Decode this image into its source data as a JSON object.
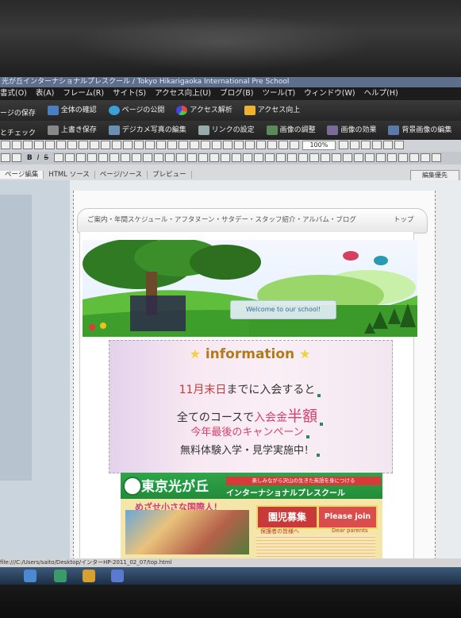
{
  "window": {
    "title": "光が丘インターナショナルプレスクール / Tokyo Hikarigaoka International Pre School"
  },
  "menu": [
    "書式(O)",
    "表(A)",
    "フレーム(R)",
    "サイト(S)",
    "アクセス向上(U)",
    "ブログ(B)",
    "ツール(T)",
    "ウィンドウ(W)",
    "ヘルプ(H)"
  ],
  "toolbar1": {
    "save": "ージの保存",
    "overall_check": "全体の確認",
    "publish": "ページの公開",
    "access_analysis": "アクセス解析",
    "access_up": "アクセス向上"
  },
  "toolbar2": {
    "check": "とチェック",
    "overwrite_save": "上書き保存",
    "photo_edit": "デジカメ写真の編集",
    "link_settings": "リンクの設定",
    "image_adjust": "画像の調整",
    "image_effect": "画像の効果",
    "bg_image_edit": "背景画像の編集"
  },
  "format": {
    "zoom": "100%"
  },
  "tabs": [
    "ページ編集",
    "HTML ソース",
    "ページ/ソース",
    "プレビュー"
  ],
  "mode_select": "編集優先",
  "page": {
    "nav_links": "ご案内・年間スケジュール・アフタヌーン・サタデー・スタッフ紹介・アルバム・ブログ",
    "nav_top": "トップ",
    "welcome": "Welcome to our school!",
    "info_title": "information",
    "line1_red": "11月末日",
    "line1_rest": "までに入会すると",
    "line2_a": "全てのコースで",
    "line2_b": "入会金",
    "line2_c": "半額",
    "line3": "今年最後のキャンペーン",
    "line4": "無料体験入学・見学実施中！",
    "school_name": "東京光が丘",
    "school_sub": "楽しみながら沢山の生きた英語を身につける",
    "school_sub2": "インターナショナルプレスクール",
    "mezase": "めざせ小さな国際人！",
    "enji": "園児募集",
    "join": "Please join us",
    "hogosha": "保護者の皆様へ",
    "dear": "Dear parents"
  },
  "status_bar": "file:///C:/Users/saito/Desktop/インターHP-2011_02_07/top.html",
  "colors": {
    "info_title": "#b27a1a",
    "accent_red": "#c43a3a",
    "accent_pink": "#d8406a",
    "school_green": "#2fa548"
  }
}
